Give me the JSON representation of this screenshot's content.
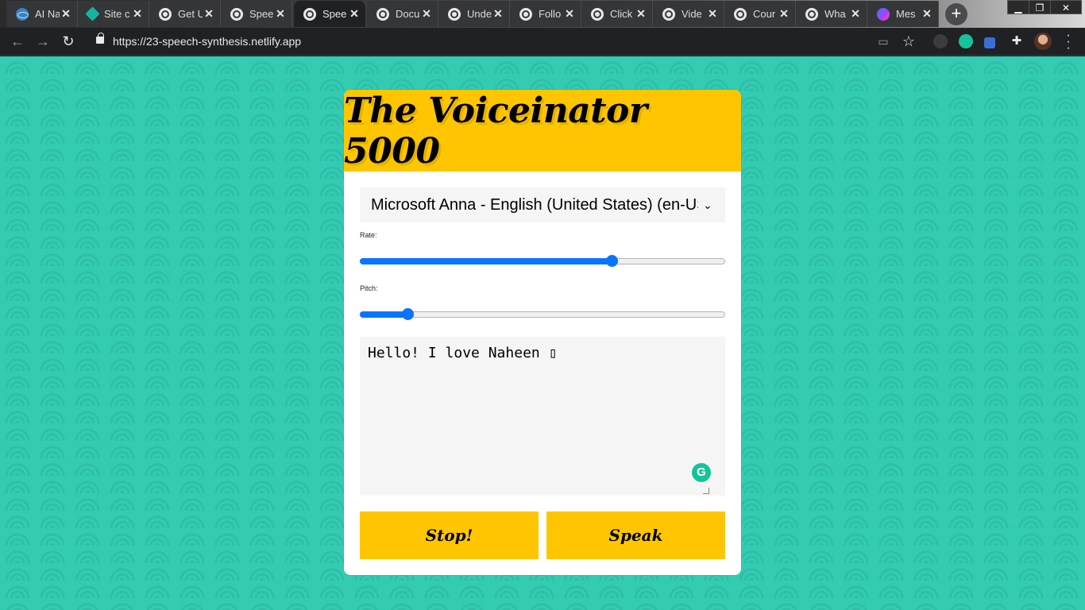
{
  "browser": {
    "tabs": [
      {
        "title": "AI Na",
        "icon": "react-icon"
      },
      {
        "title": "Site c",
        "icon": "site-icon"
      },
      {
        "title": "Get U",
        "icon": "globe-icon"
      },
      {
        "title": "Spee",
        "icon": "globe-icon"
      },
      {
        "title": "Spee",
        "icon": "globe-icon",
        "active": true
      },
      {
        "title": "Docu",
        "icon": "globe-icon"
      },
      {
        "title": "Unde",
        "icon": "globe-icon"
      },
      {
        "title": "Follo",
        "icon": "globe-icon"
      },
      {
        "title": "Click",
        "icon": "globe-icon"
      },
      {
        "title": "Vide",
        "icon": "globe-icon"
      },
      {
        "title": "Cour",
        "icon": "globe-icon"
      },
      {
        "title": "Wha",
        "icon": "globe-icon"
      },
      {
        "title": "Mes",
        "icon": "messenger-icon"
      }
    ],
    "url": "https://23-speech-synthesis.netlify.app",
    "new_tab_label": "+"
  },
  "app": {
    "title": "The Voiceinator 5000",
    "voice_selected": "Microsoft Anna - English (United States) (en-US)",
    "rate_label": "Rate:",
    "rate_value": 0.69,
    "pitch_label": "Pitch:",
    "pitch_value": 0.13,
    "message": "Hello! I love Naheen ▯",
    "stop_label": "Stop!",
    "speak_label": "Speak"
  },
  "colors": {
    "background": "#33ccb3",
    "accent": "#ffc600",
    "slider": "#0a74ff"
  }
}
